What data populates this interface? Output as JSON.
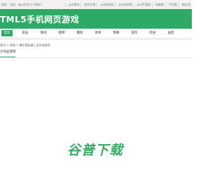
{
  "topbar": {
    "welcome": "您好，欢迎，放心好专主下载站！",
    "links": [
      "ps4游戏",
      "软件分类",
      "ps4游戏网",
      "ps4安卓网",
      "ps4手游网",
      "电脑版",
      "手机版",
      "精品游"
    ]
  },
  "header": {
    "logo": "TML5手机网页游戏"
  },
  "catnav": {
    "items": [
      "首页",
      "射击",
      "休闲",
      "棋牌",
      "模拟",
      "体育",
      "策略",
      "冒险",
      "装扮",
      "益智"
    ],
    "active_index": 0
  },
  "breadcrumb": "首页 > 网游 > 模中国际真三文件战游戏",
  "section": {
    "title": "大作品游戏"
  },
  "watermark": {
    "text": "谷普下载"
  },
  "colors": {
    "brand": "#2eaa67"
  }
}
